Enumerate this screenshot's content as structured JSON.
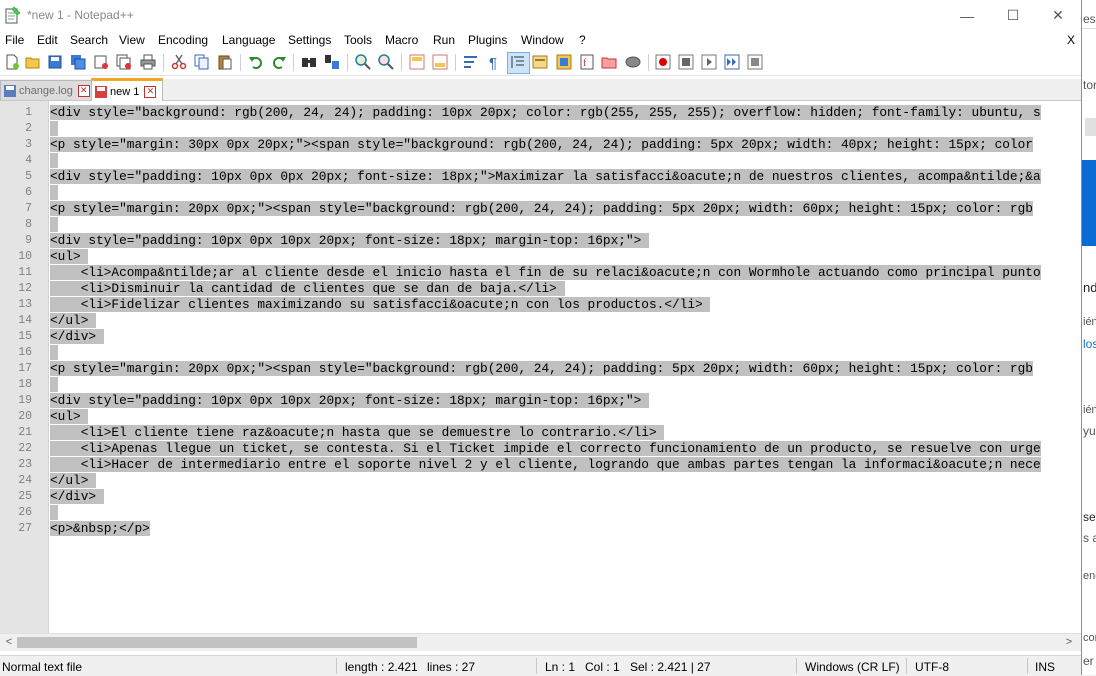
{
  "window": {
    "title": "*new 1 - Notepad++",
    "minimize": "—",
    "maximize": "☐",
    "close": "✕"
  },
  "menu": {
    "items": [
      "File",
      "Edit",
      "Search",
      "View",
      "Encoding",
      "Language",
      "Settings",
      "Tools",
      "Macro",
      "Run",
      "Plugins",
      "Window",
      "?"
    ],
    "close_doc": "X"
  },
  "toolbar": {
    "icons": [
      "new-file-icon",
      "open-file-icon",
      "save-icon",
      "save-all-icon",
      "close-icon",
      "close-all-icon",
      "print-icon",
      "cut-icon",
      "copy-icon",
      "paste-icon",
      "undo-icon",
      "redo-icon",
      "find-icon",
      "replace-icon",
      "zoom-in-icon",
      "zoom-out-icon",
      "sync-vertical-icon",
      "sync-horizontal-icon",
      "word-wrap-icon",
      "show-all-chars-icon",
      "indent-guide-icon",
      "udl-icon",
      "doc-map-icon",
      "function-list-icon",
      "folder-workspace-icon",
      "monitoring-icon",
      "record-macro-icon",
      "stop-macro-icon",
      "play-macro-icon",
      "run-macro-multiple-icon",
      "save-macro-icon"
    ]
  },
  "tabs": [
    {
      "label": "change.log",
      "active": false
    },
    {
      "label": "new 1",
      "active": true
    }
  ],
  "editor": {
    "lines": [
      {
        "num": "1",
        "text": "<div style=\"background: rgb(200, 24, 24); padding: 10px 20px; color: rgb(255, 255, 255); overflow: hidden; font-family: ubuntu, s"
      },
      {
        "num": "2",
        "text": " "
      },
      {
        "num": "3",
        "text": "<p style=\"margin: 30px 0px 20px;\"><span style=\"background: rgb(200, 24, 24); padding: 5px 20px; width: 40px; height: 15px; color"
      },
      {
        "num": "4",
        "text": " "
      },
      {
        "num": "5",
        "text": "<div style=\"padding: 10px 0px 0px 20px; font-size: 18px;\">Maximizar la satisfacci&oacute;n de nuestros clientes, acompa&ntilde;&a"
      },
      {
        "num": "6",
        "text": " "
      },
      {
        "num": "7",
        "text": "<p style=\"margin: 20px 0px;\"><span style=\"background: rgb(200, 24, 24); padding: 5px 20px; width: 60px; height: 15px; color: rgb"
      },
      {
        "num": "8",
        "text": " "
      },
      {
        "num": "9",
        "text": "<div style=\"padding: 10px 0px 10px 20px; font-size: 18px; margin-top: 16px;\"> "
      },
      {
        "num": "10",
        "text": "<ul> "
      },
      {
        "num": "11",
        "text": "    <li>Acompa&ntilde;ar al cliente desde el inicio hasta el fin de su relaci&oacute;n con Wormhole actuando como principal punto"
      },
      {
        "num": "12",
        "text": "    <li>Disminuir la cantidad de clientes que se dan de baja.</li> "
      },
      {
        "num": "13",
        "text": "    <li>Fidelizar clientes maximizando su satisfacci&oacute;n con los productos.</li> "
      },
      {
        "num": "14",
        "text": "</ul> "
      },
      {
        "num": "15",
        "text": "</div> "
      },
      {
        "num": "16",
        "text": " "
      },
      {
        "num": "17",
        "text": "<p style=\"margin: 20px 0px;\"><span style=\"background: rgb(200, 24, 24); padding: 5px 20px; width: 60px; height: 15px; color: rgb"
      },
      {
        "num": "18",
        "text": " "
      },
      {
        "num": "19",
        "text": "<div style=\"padding: 10px 0px 10px 20px; font-size: 18px; margin-top: 16px;\"> "
      },
      {
        "num": "20",
        "text": "<ul> "
      },
      {
        "num": "21",
        "text": "    <li>El cliente tiene raz&oacute;n hasta que se demuestre lo contrario.</li> "
      },
      {
        "num": "22",
        "text": "    <li>Apenas llegue un ticket, se contesta. Si el Ticket impide el correcto funcionamiento de un producto, se resuelve con urge"
      },
      {
        "num": "23",
        "text": "    <li>Hacer de intermediario entre el soporte nivel 2 y el cliente, logrando que ambas partes tengan la informaci&oacute;n nece"
      },
      {
        "num": "24",
        "text": "</ul> "
      },
      {
        "num": "25",
        "text": "</div> "
      },
      {
        "num": "26",
        "text": " "
      },
      {
        "num": "27",
        "text": "<p>&nbsp;</p>"
      }
    ]
  },
  "scrollbar": {
    "left": "<",
    "right": ">"
  },
  "status": {
    "type": "Normal text file",
    "length": "length : 2.421",
    "lines": "lines : 27",
    "ln": "Ln : 1",
    "col": "Col : 1",
    "sel": "Sel : 2.421 | 27",
    "eol": "Windows (CR LF)",
    "encoding": "UTF-8",
    "mode": "INS"
  },
  "background_window": {
    "fragments": [
      "ess",
      "tor",
      "nd",
      "ién",
      "los",
      "ién",
      "yu",
      "se",
      "s a",
      "ene",
      "cor",
      "er a"
    ]
  }
}
